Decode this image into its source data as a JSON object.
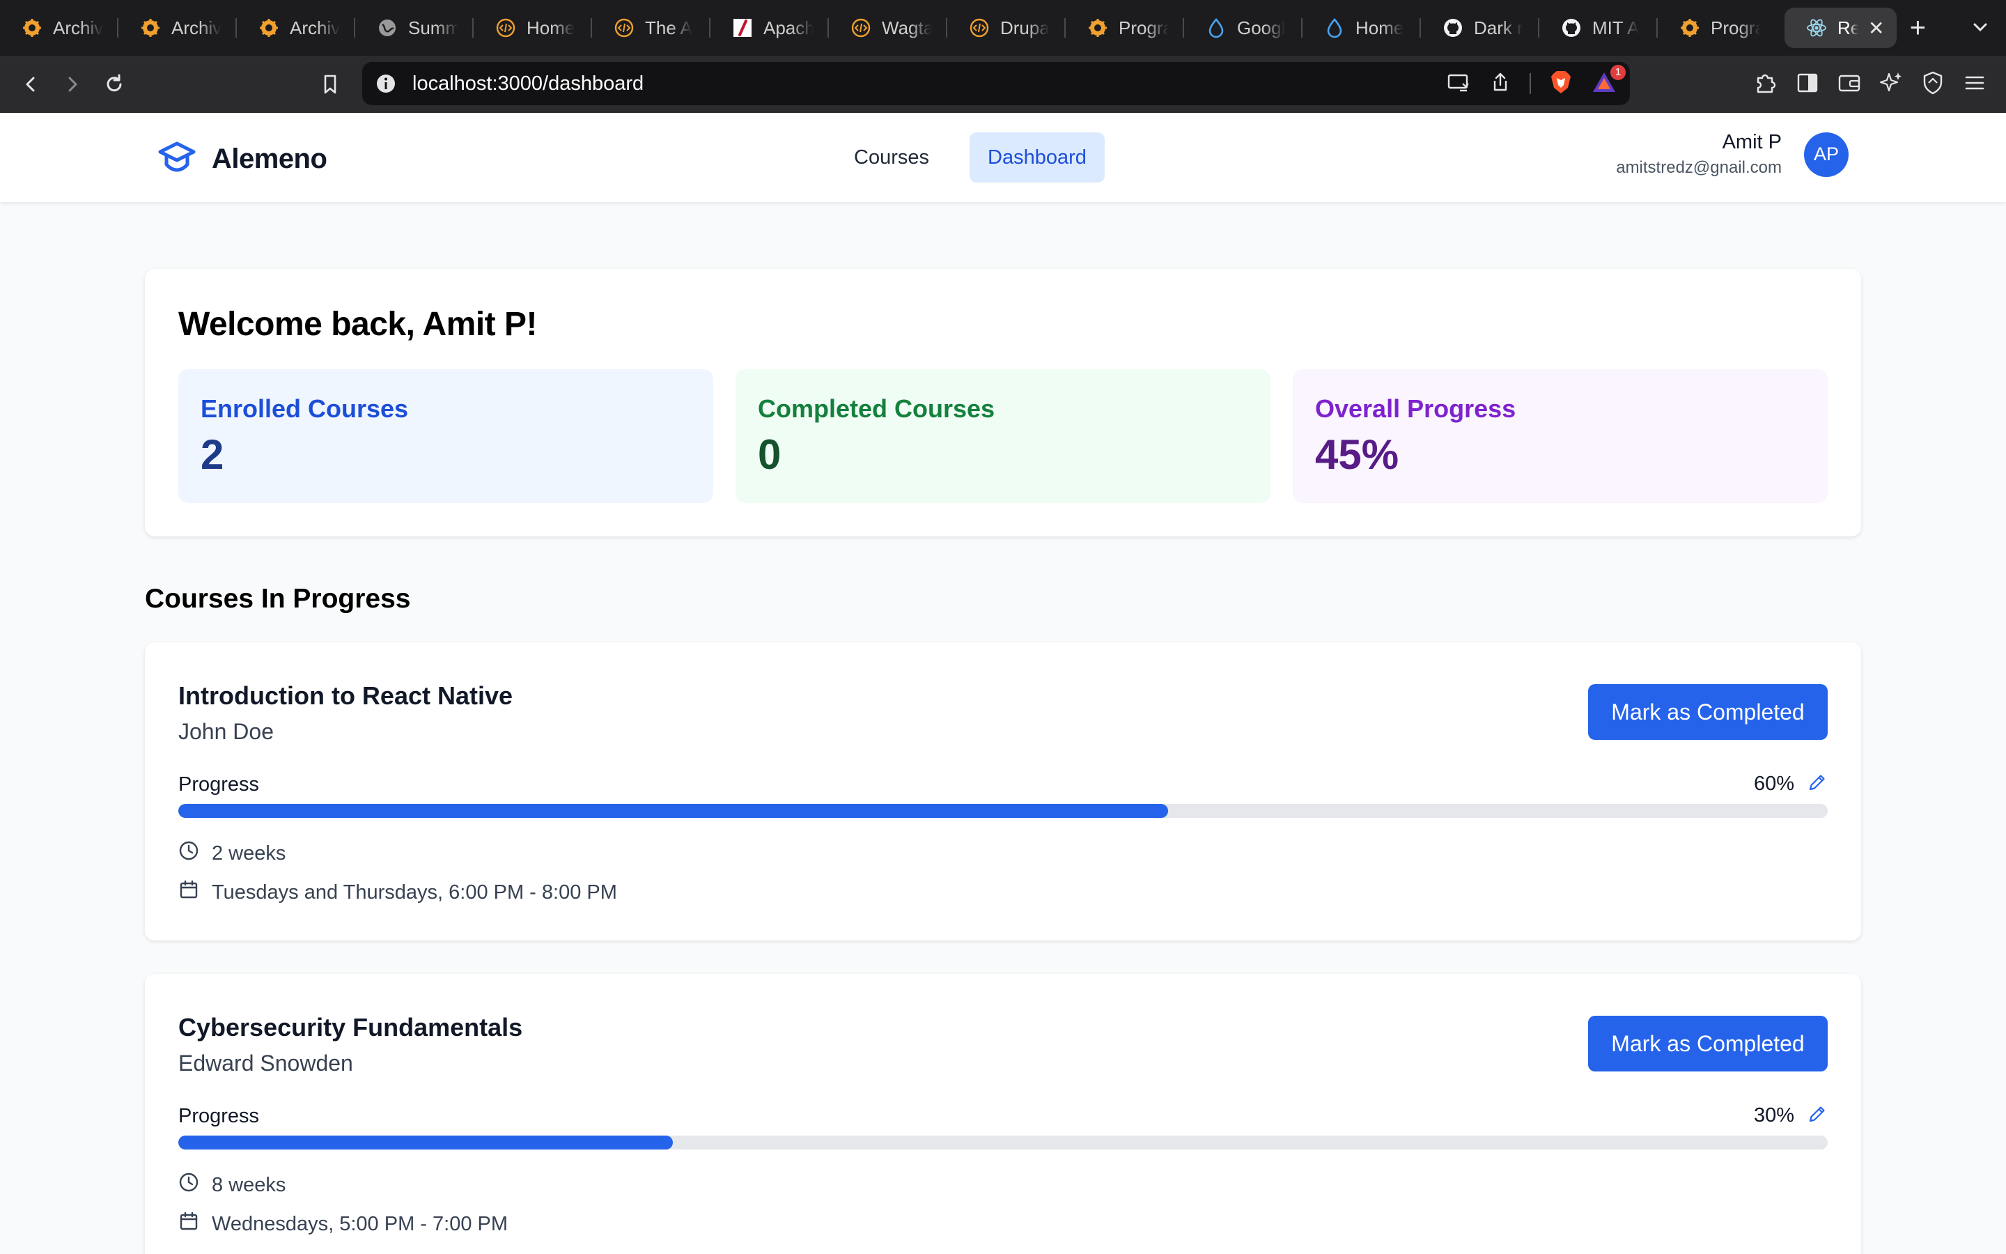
{
  "browser": {
    "tabs": [
      {
        "title": "Archiv",
        "icon": "gear-favicon"
      },
      {
        "title": "Archiv",
        "icon": "gear-favicon"
      },
      {
        "title": "Archiv",
        "icon": "gear-favicon"
      },
      {
        "title": "Summ",
        "icon": "globe-favicon"
      },
      {
        "title": "Home",
        "icon": "code-favicon"
      },
      {
        "title": "The A",
        "icon": "code-favicon"
      },
      {
        "title": "Apach",
        "icon": "feather-favicon"
      },
      {
        "title": "Wagta",
        "icon": "code-favicon"
      },
      {
        "title": "Drupa",
        "icon": "code-favicon"
      },
      {
        "title": "Progra",
        "icon": "gear-favicon"
      },
      {
        "title": "Googl",
        "icon": "drop-favicon"
      },
      {
        "title": "Home",
        "icon": "drop-favicon"
      },
      {
        "title": "Dark r",
        "icon": "github-favicon"
      },
      {
        "title": "MIT A",
        "icon": "github-favicon"
      },
      {
        "title": "Progra",
        "icon": "gear-favicon"
      }
    ],
    "active_tab": {
      "title": "Re",
      "icon": "react-favicon"
    },
    "url": "localhost:3000/dashboard",
    "badge_count": "1"
  },
  "header": {
    "brand": "Alemeno",
    "nav": [
      {
        "label": "Courses",
        "active": false
      },
      {
        "label": "Dashboard",
        "active": true
      }
    ],
    "user": {
      "name": "Amit P",
      "email": "amitstredz@gnail.com",
      "initials": "AP"
    }
  },
  "welcome": {
    "title": "Welcome back, Amit P!",
    "stats": [
      {
        "label": "Enrolled Courses",
        "value": "2",
        "color": "#1d4ed8"
      },
      {
        "label": "Completed Courses",
        "value": "0",
        "color": "#15803d"
      },
      {
        "label": "Overall Progress",
        "value": "45%",
        "color": "#7e22ce"
      }
    ]
  },
  "section_title": "Courses In Progress",
  "courses": [
    {
      "title": "Introduction to React Native",
      "instructor": "John Doe",
      "button": "Mark as Completed",
      "progress_label": "Progress",
      "progress_text": "60%",
      "progress": 0.6,
      "duration": "2 weeks",
      "schedule": "Tuesdays and Thursdays, 6:00 PM - 8:00 PM"
    },
    {
      "title": "Cybersecurity Fundamentals",
      "instructor": "Edward Snowden",
      "button": "Mark as Completed",
      "progress_label": "Progress",
      "progress_text": "30%",
      "progress": 0.3,
      "duration": "8 weeks",
      "schedule": "Wednesdays, 5:00 PM - 7:00 PM"
    }
  ],
  "colors": {
    "accent": "#2563eb",
    "accent_light": "#dbeafe"
  }
}
